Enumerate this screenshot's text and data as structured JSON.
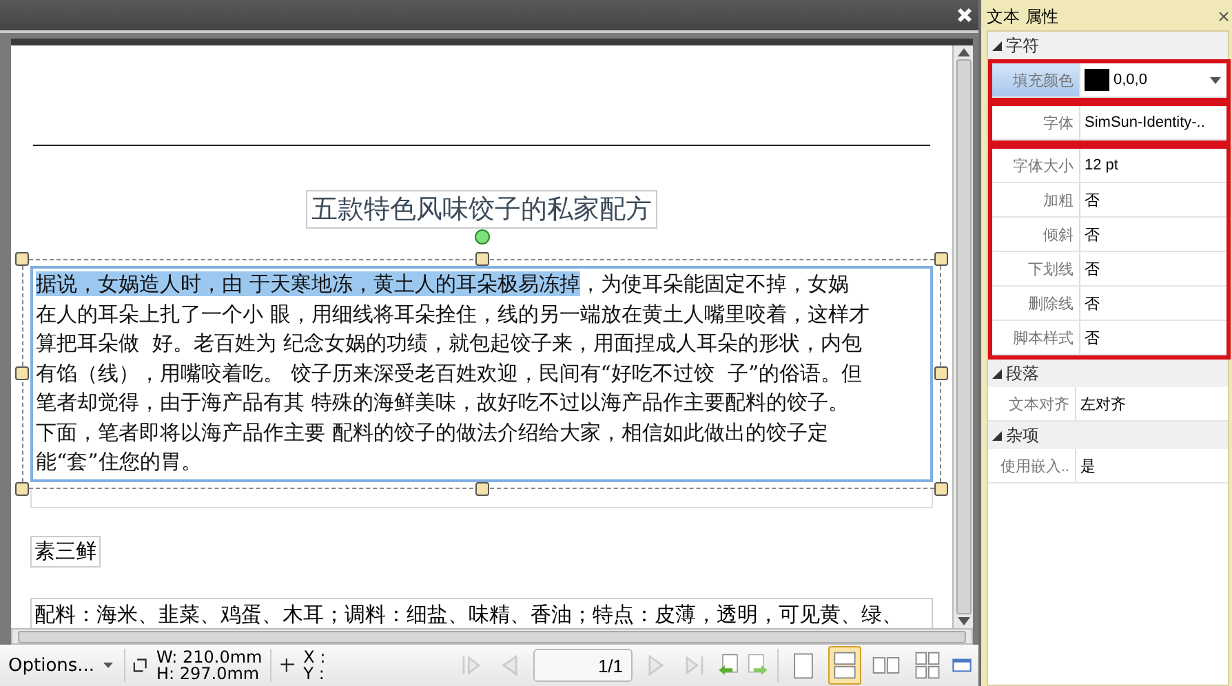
{
  "document": {
    "title": "五款特色风味饺子的私家配方",
    "paragraph": {
      "selection": "据说，女娲造人时，由 于天寒地冻，黄土人的耳朵极易冻掉",
      "lines": [
        "，为使耳朵能固定不掉，女娲",
        "在人的耳朵上扎了一个小 眼，用细线将耳朵拴住，线的另一端放在黄土人嘴里咬着，这样才",
        "算把耳朵做  好。老百姓为 纪念女娲的功绩，就包起饺子来，用面捏成人耳朵的形状，内包",
        "有馅（线），用嘴咬着吃。 饺子历来深受老百姓欢迎，民间有“好吃不过饺  子”的俗语。但",
        "笔者却觉得，由于海产品有其 特殊的海鲜美味，故好吃不过以海产品作主要配料的饺子。",
        "下面，笔者即将以海产品作主要 配料的饺子的做法介绍给大家，相信如此做出的饺子定",
        "能“套”住您的胃。"
      ]
    },
    "heading": "素三鲜",
    "ingredients": "配料：海米、韭菜、鸡蛋、木耳；调料：细盐、味精、香油；特点：皮薄，透明，可见黄、绿、"
  },
  "toolbar": {
    "options": "Options...",
    "width": "W: 210.0mm",
    "height": "H: 297.0mm",
    "x": "X :",
    "y": "Y :",
    "page": "1/1",
    "nav": [
      {
        "kind": "first",
        "disabled": true
      },
      {
        "kind": "prev",
        "disabled": true
      },
      {
        "kind": "next",
        "disabled": true
      },
      {
        "kind": "last",
        "disabled": true
      }
    ],
    "views": [
      {
        "kind": "single",
        "selected": false
      },
      {
        "kind": "continuous",
        "selected": true
      },
      {
        "kind": "two",
        "selected": false
      },
      {
        "kind": "four",
        "selected": false
      }
    ]
  },
  "properties": {
    "title": "文本 属性",
    "sections": [
      {
        "title": "字符",
        "expanded": true,
        "groups": [
          {
            "highlighted": true,
            "rows": [
              {
                "label": "填充颜色",
                "value": "0,0,0",
                "kind": "color",
                "selected": true
              }
            ]
          },
          {
            "highlighted": true,
            "rows": [
              {
                "label": "字体",
                "value": "SimSun-Identity-..",
                "kind": "text",
                "selected": false
              }
            ]
          },
          {
            "highlighted": true,
            "rows": [
              {
                "label": "字体大小",
                "value": "12 pt",
                "kind": "text",
                "selected": false
              },
              {
                "label": "加粗",
                "value": "否",
                "kind": "text",
                "selected": false
              },
              {
                "label": "倾斜",
                "value": "否",
                "kind": "text",
                "selected": false
              },
              {
                "label": "下划线",
                "value": "否",
                "kind": "text",
                "selected": false
              },
              {
                "label": "删除线",
                "value": "否",
                "kind": "text",
                "selected": false
              },
              {
                "label": "脚本样式",
                "value": "否",
                "kind": "text",
                "selected": false
              }
            ]
          }
        ]
      },
      {
        "title": "段落",
        "expanded": true,
        "groups": [
          {
            "highlighted": false,
            "rows": [
              {
                "label": "文本对齐",
                "value": "左对齐",
                "kind": "text",
                "selected": false
              }
            ]
          }
        ]
      },
      {
        "title": "杂项",
        "expanded": true,
        "groups": [
          {
            "highlighted": false,
            "rows": [
              {
                "label": "使用嵌入..",
                "value": "是",
                "kind": "text",
                "selected": false
              }
            ]
          }
        ]
      }
    ]
  }
}
